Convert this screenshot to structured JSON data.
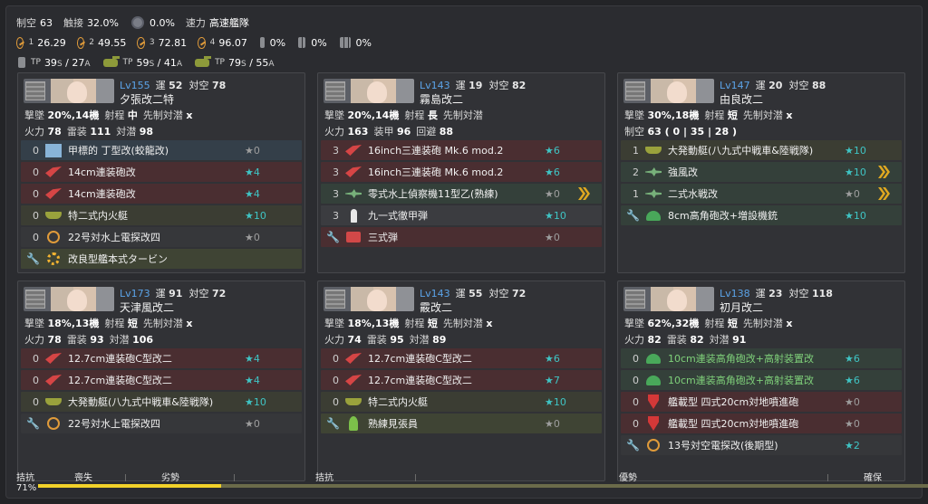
{
  "summary": {
    "air_label": "制空",
    "air": "63",
    "los_label": "触接",
    "los": "32.0%",
    "recon": "0.0%",
    "speed_label": "速力",
    "speed": "高速艦隊",
    "los_scores": [
      {
        "pre": "1",
        "val": "26.29"
      },
      {
        "pre": "2",
        "val": "49.55"
      },
      {
        "pre": "3",
        "val": "72.81"
      },
      {
        "pre": "4",
        "val": "96.07"
      }
    ],
    "drum1": "0%",
    "drum2": "0%",
    "drum3": "0%",
    "tp": [
      {
        "a": "39",
        "b": "27"
      },
      {
        "a": "59",
        "b": "41"
      },
      {
        "a": "79",
        "b": "55"
      }
    ]
  },
  "labels": {
    "luck": "運",
    "aa": "対空",
    "asw": "対潜",
    "fire": "火力",
    "torp": "雷装",
    "armor": "装甲",
    "evasion": "回避",
    "range": "射程",
    "preasw": "先制対潜",
    "air": "制空"
  },
  "ships": [
    {
      "lv": "Lv155",
      "luck": "52",
      "aa": "78",
      "name": "夕張改二特",
      "line1a": "撃墜",
      "line1b": "20%,14機",
      "range": "中",
      "preasw": "x",
      "stats": [
        {
          "k": "火力",
          "v": "78"
        },
        {
          "k": "雷装",
          "v": "111"
        },
        {
          "k": "対潜",
          "v": "98"
        }
      ],
      "slots": [
        {
          "cnt": "0",
          "icon": "torp",
          "name": "甲標的 丁型改(蛟龍改)",
          "stars": "★0",
          "t": false,
          "bg": "blue"
        },
        {
          "cnt": "0",
          "icon": "gun",
          "name": "14cm連装砲改",
          "stars": "★4",
          "t": true,
          "bg": "red"
        },
        {
          "cnt": "0",
          "icon": "gun",
          "name": "14cm連装砲改",
          "stars": "★4",
          "t": true,
          "bg": "red"
        },
        {
          "cnt": "0",
          "icon": "boat",
          "name": "特二式内火艇",
          "stars": "★10",
          "t": true,
          "bg": "olive"
        },
        {
          "cnt": "0",
          "icon": "radar",
          "name": "22号対水上電探改四",
          "stars": "★0",
          "t": false,
          "bg": "dark"
        },
        {
          "cnt": "",
          "icon": "turb",
          "name": "改良型艦本式タービン",
          "stars": "",
          "t": false,
          "bg": "pale",
          "ex": true
        }
      ]
    },
    {
      "lv": "Lv143",
      "luck": "19",
      "aa": "82",
      "name": "霧島改二",
      "line1a": "撃墜",
      "line1b": "20%,14機",
      "range": "長",
      "preasw": "",
      "stats": [
        {
          "k": "火力",
          "v": "163"
        },
        {
          "k": "装甲",
          "v": "96"
        },
        {
          "k": "回避",
          "v": "88"
        }
      ],
      "slots": [
        {
          "cnt": "3",
          "icon": "gun",
          "name": "16inch三連装砲 Mk.6 mod.2",
          "stars": "★6",
          "t": true,
          "bg": "red"
        },
        {
          "cnt": "3",
          "icon": "gun",
          "name": "16inch三連装砲 Mk.6 mod.2",
          "stars": "★6",
          "t": true,
          "bg": "red"
        },
        {
          "cnt": "3",
          "icon": "plane",
          "name": "零式水上偵察機11型乙(熟練)",
          "stars": "★0",
          "t": false,
          "bg": "green",
          "chev": true
        },
        {
          "cnt": "3",
          "icon": "shell",
          "name": "九一式徹甲弾",
          "stars": "★10",
          "t": true,
          "bg": "gray"
        },
        {
          "cnt": "",
          "icon": "bullet",
          "name": "三式弾",
          "stars": "★0",
          "t": false,
          "bg": "red",
          "ex": true
        }
      ]
    },
    {
      "lv": "Lv147",
      "luck": "20",
      "aa": "88",
      "name": "由良改二",
      "line1a": "撃墜",
      "line1b": "30%,18機",
      "range": "短",
      "preasw": "x",
      "air_label": "制空",
      "air_line": "63 ( 0 | 35 | 28 )",
      "stats": [],
      "slots": [
        {
          "cnt": "1",
          "icon": "boat",
          "name": "大発動艇(八九式中戦車&陸戦隊)",
          "stars": "★10",
          "t": true,
          "bg": "olive"
        },
        {
          "cnt": "2",
          "icon": "plane",
          "name": "強風改",
          "stars": "★10",
          "t": true,
          "bg": "green",
          "chev": true
        },
        {
          "cnt": "1",
          "icon": "plane",
          "name": "二式水戦改",
          "stars": "★0",
          "t": false,
          "bg": "green",
          "chev": true
        },
        {
          "cnt": "",
          "icon": "aa",
          "name": "8cm高角砲改+増設機銃",
          "stars": "★10",
          "t": true,
          "bg": "green",
          "ex": true
        }
      ]
    },
    {
      "lv": "Lv173",
      "luck": "91",
      "aa": "72",
      "name": "天津風改二",
      "line1a": "撃墜",
      "line1b": "18%,13機",
      "range": "短",
      "preasw": "x",
      "stats": [
        {
          "k": "火力",
          "v": "78"
        },
        {
          "k": "雷装",
          "v": "93"
        },
        {
          "k": "対潜",
          "v": "106"
        }
      ],
      "slots": [
        {
          "cnt": "0",
          "icon": "gun",
          "name": "12.7cm連装砲C型改二",
          "stars": "★4",
          "t": true,
          "bg": "red"
        },
        {
          "cnt": "0",
          "icon": "gun",
          "name": "12.7cm連装砲C型改二",
          "stars": "★4",
          "t": true,
          "bg": "red"
        },
        {
          "cnt": "0",
          "icon": "boat",
          "name": "大発動艇(八九式中戦車&陸戦隊)",
          "stars": "★10",
          "t": true,
          "bg": "olive"
        },
        {
          "cnt": "",
          "icon": "radar",
          "name": "22号対水上電探改四",
          "stars": "★0",
          "t": false,
          "bg": "dark",
          "ex": true
        }
      ]
    },
    {
      "lv": "Lv143",
      "luck": "55",
      "aa": "72",
      "name": "霰改二",
      "line1a": "撃墜",
      "line1b": "18%,13機",
      "range": "短",
      "preasw": "x",
      "stats": [
        {
          "k": "火力",
          "v": "74"
        },
        {
          "k": "雷装",
          "v": "95"
        },
        {
          "k": "対潜",
          "v": "89"
        }
      ],
      "slots": [
        {
          "cnt": "0",
          "icon": "gun",
          "name": "12.7cm連装砲C型改二",
          "stars": "★6",
          "t": true,
          "bg": "red"
        },
        {
          "cnt": "0",
          "icon": "gun",
          "name": "12.7cm連装砲C型改二",
          "stars": "★7",
          "t": true,
          "bg": "red"
        },
        {
          "cnt": "0",
          "icon": "boat",
          "name": "特二式内火艇",
          "stars": "★10",
          "t": true,
          "bg": "olive"
        },
        {
          "cnt": "",
          "icon": "man",
          "name": "熟練見張員",
          "stars": "★0",
          "t": false,
          "bg": "pale",
          "ex": true
        }
      ]
    },
    {
      "lv": "Lv138",
      "luck": "23",
      "aa": "118",
      "name": "初月改二",
      "line1a": "撃墜",
      "line1b": "62%,32機",
      "range": "短",
      "preasw": "x",
      "stats": [
        {
          "k": "火力",
          "v": "82"
        },
        {
          "k": "雷装",
          "v": "82"
        },
        {
          "k": "対潜",
          "v": "91"
        }
      ],
      "slots": [
        {
          "cnt": "0",
          "icon": "aa",
          "name": "10cm連装高角砲改+高射装置改",
          "stars": "★6",
          "t": true,
          "bg": "green",
          "green": true
        },
        {
          "cnt": "0",
          "icon": "aa",
          "name": "10cm連装高角砲改+高射装置改",
          "stars": "★6",
          "t": true,
          "bg": "green",
          "green": true
        },
        {
          "cnt": "0",
          "icon": "depth",
          "name": "艦載型 四式20cm対地噴進砲",
          "stars": "★0",
          "t": false,
          "bg": "red"
        },
        {
          "cnt": "0",
          "icon": "depth",
          "name": "艦載型 四式20cm対地噴進砲",
          "stars": "★0",
          "t": false,
          "bg": "red"
        },
        {
          "cnt": "",
          "icon": "radar",
          "name": "13号対空電探改(後期型)",
          "stars": "★2",
          "t": true,
          "bg": "dark",
          "ex": true
        }
      ]
    }
  ],
  "airbar": {
    "title": "拮抗",
    "pct": "71%",
    "ticks": [
      "喪失",
      "劣勢",
      "拮抗",
      "優勢",
      "確保"
    ],
    "fill_fraction": 0.205
  }
}
